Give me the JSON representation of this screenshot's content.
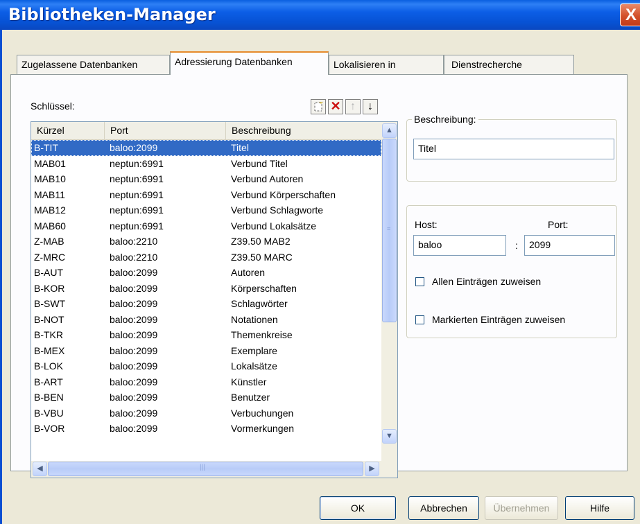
{
  "window": {
    "title": "Bibliotheken-Manager",
    "close_glyph": "X"
  },
  "tabs": [
    {
      "label": "Zugelassene Datenbanken"
    },
    {
      "label": "Adressierung Datenbanken",
      "active": true
    },
    {
      "label": "Lokalisieren in"
    },
    {
      "label": "Dienstrecherche"
    }
  ],
  "keys": {
    "label": "Schlüssel:",
    "toolbar": [
      {
        "icon": "new-icon"
      },
      {
        "icon": "delete-icon",
        "glyph": "✕"
      },
      {
        "icon": "arrow-up-icon",
        "glyph": "↑"
      },
      {
        "icon": "arrow-down-icon",
        "glyph": "↓"
      }
    ],
    "columns": [
      "Kürzel",
      "Port",
      "Beschreibung"
    ],
    "rows": [
      [
        "B-TIT",
        "baloo:2099",
        "Titel"
      ],
      [
        "MAB01",
        "neptun:6991",
        "Verbund Titel"
      ],
      [
        "MAB10",
        "neptun:6991",
        "Verbund Autoren"
      ],
      [
        "MAB11",
        "neptun:6991",
        "Verbund Körperschaften"
      ],
      [
        "MAB12",
        "neptun:6991",
        "Verbund Schlagworte"
      ],
      [
        "MAB60",
        "neptun:6991",
        "Verbund Lokalsätze"
      ],
      [
        "Z-MAB",
        "baloo:2210",
        "Z39.50 MAB2"
      ],
      [
        "Z-MRC",
        "baloo:2210",
        "Z39.50 MARC"
      ],
      [
        "B-AUT",
        "baloo:2099",
        "Autoren"
      ],
      [
        "B-KOR",
        "baloo:2099",
        "Körperschaften"
      ],
      [
        "B-SWT",
        "baloo:2099",
        "Schlagwörter"
      ],
      [
        "B-NOT",
        "baloo:2099",
        "Notationen"
      ],
      [
        "B-TKR",
        "baloo:2099",
        "Themenkreise"
      ],
      [
        "B-MEX",
        "baloo:2099",
        "Exemplare"
      ],
      [
        "B-LOK",
        "baloo:2099",
        "Lokalsätze"
      ],
      [
        "B-ART",
        "baloo:2099",
        "Künstler"
      ],
      [
        "B-BEN",
        "baloo:2099",
        "Benutzer"
      ],
      [
        "B-VBU",
        "baloo:2099",
        "Verbuchungen"
      ],
      [
        "B-VOR",
        "baloo:2099",
        "Vormerkungen"
      ]
    ],
    "selected_index": 0
  },
  "description": {
    "legend": "Beschreibung:",
    "value": "Titel"
  },
  "connection": {
    "host_label": "Host:",
    "port_label": "Port:",
    "separator": ":",
    "host_value": "baloo",
    "port_value": "2099",
    "assign_all_label": "Allen Einträgen zuweisen",
    "assign_marked_label": "Markierten Einträgen zuweisen"
  },
  "buttons": {
    "ok": "OK",
    "cancel": "Abbrechen",
    "apply": "Übernehmen",
    "help": "Hilfe"
  }
}
